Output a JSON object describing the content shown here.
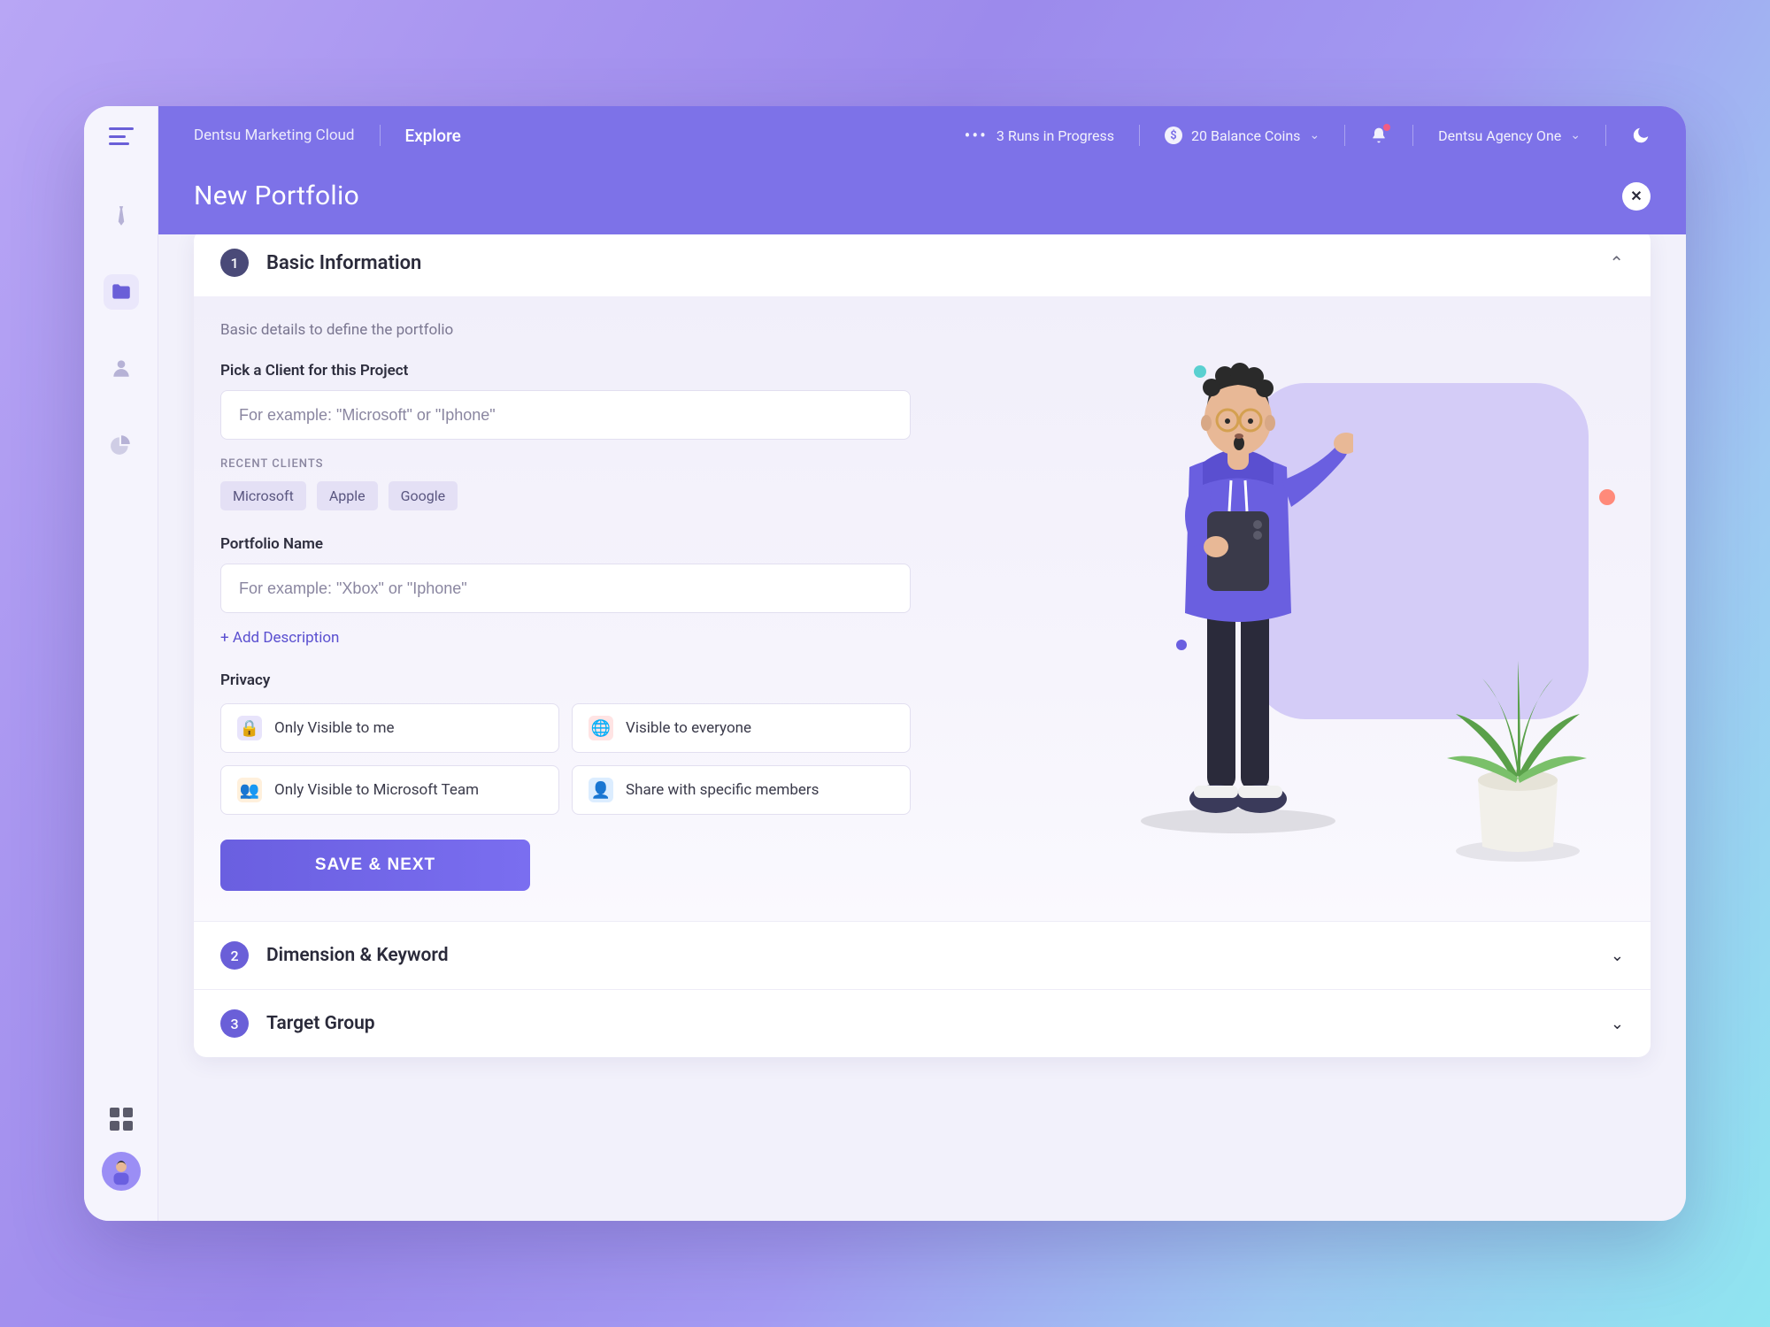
{
  "topbar": {
    "brand": "Dentsu Marketing Cloud",
    "explore": "Explore",
    "runs": "3 Runs in Progress",
    "coins": "20 Balance Coins",
    "agency": "Dentsu Agency One"
  },
  "page": {
    "title": "New Portfolio"
  },
  "sections": {
    "s1": {
      "num": "1",
      "title": "Basic Information"
    },
    "s2": {
      "num": "2",
      "title": "Dimension & Keyword"
    },
    "s3": {
      "num": "3",
      "title": "Target Group"
    }
  },
  "form": {
    "subtext": "Basic details to define the portfolio",
    "client_label": "Pick a Client for this Project",
    "client_placeholder": "For example: \"Microsoft\" or \"Iphone\"",
    "recent_label": "RECENT CLIENTS",
    "recent": {
      "c0": "Microsoft",
      "c1": "Apple",
      "c2": "Google"
    },
    "name_label": "Portfolio Name",
    "name_placeholder": "For example: \"Xbox\" or \"Iphone\"",
    "add_desc": "+ Add Description",
    "privacy_label": "Privacy",
    "privacy": {
      "p0": "Only Visible to me",
      "p1": "Visible to everyone",
      "p2": "Only Visible to Microsoft Team",
      "p3": "Share with specific members"
    },
    "save": "SAVE & NEXT"
  }
}
